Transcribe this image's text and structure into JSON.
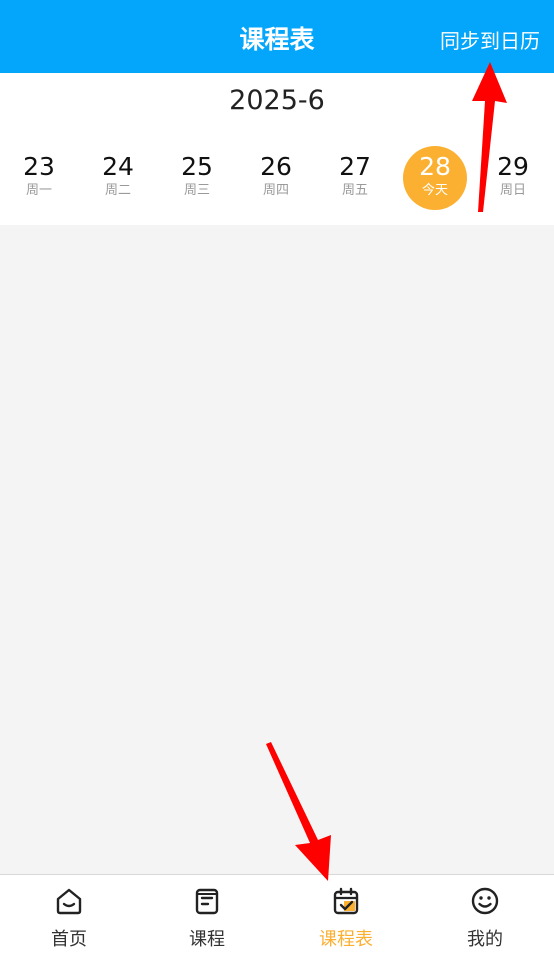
{
  "header": {
    "title": "课程表",
    "sync_label": "同步到日历"
  },
  "calendar": {
    "month": "2025-6",
    "days": [
      {
        "num": "23",
        "weekday": "周一"
      },
      {
        "num": "24",
        "weekday": "周二"
      },
      {
        "num": "25",
        "weekday": "周三"
      },
      {
        "num": "26",
        "weekday": "周四"
      },
      {
        "num": "27",
        "weekday": "周五"
      },
      {
        "num": "28",
        "weekday": "今天",
        "today": true
      },
      {
        "num": "29",
        "weekday": "周日"
      }
    ]
  },
  "tabs": [
    {
      "label": "首页",
      "icon": "home-icon"
    },
    {
      "label": "课程",
      "icon": "course-book-icon"
    },
    {
      "label": "课程表",
      "icon": "calendar-check-icon",
      "active": true
    },
    {
      "label": "我的",
      "icon": "smiley-face-icon"
    }
  ],
  "colors": {
    "header_bg": "#03a6fb",
    "accent": "#fbb032",
    "annotation": "#ff0000"
  }
}
